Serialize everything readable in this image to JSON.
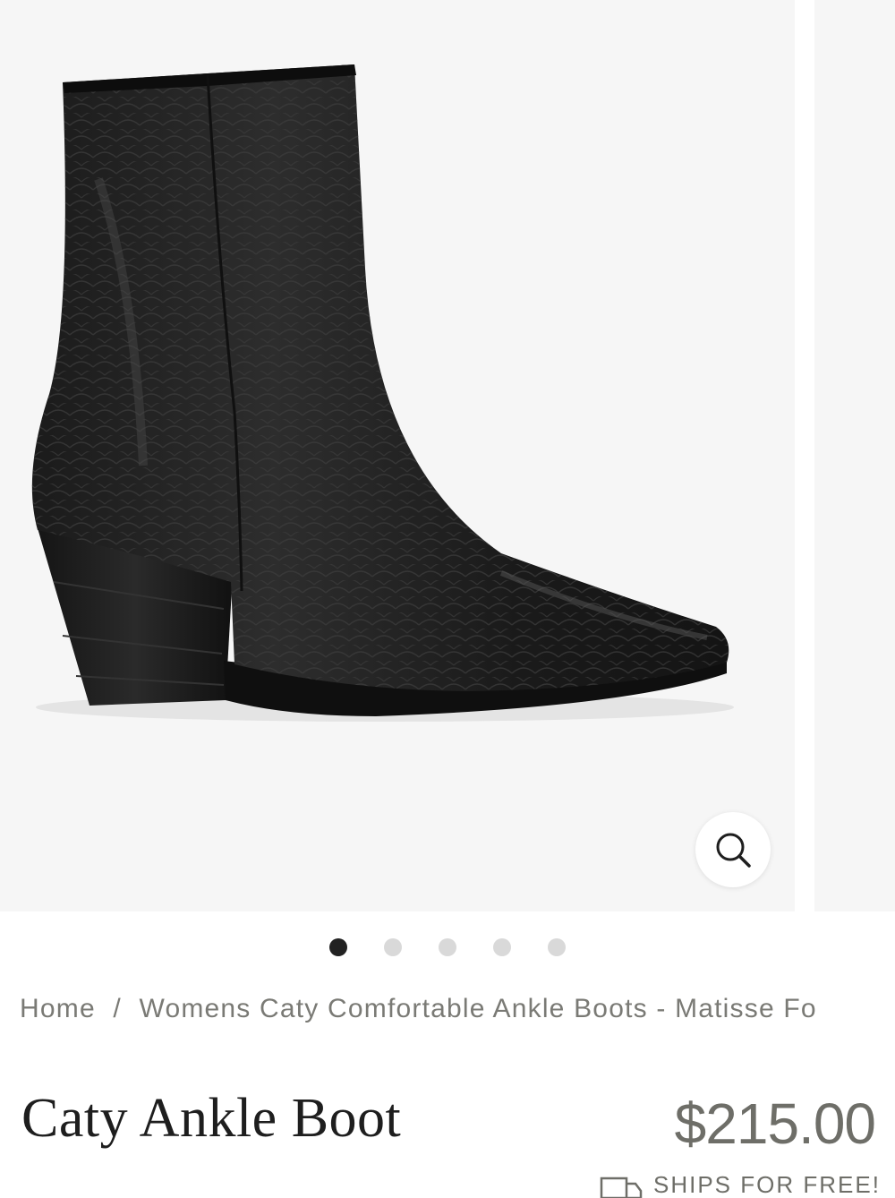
{
  "gallery": {
    "slide_count": 5,
    "active_slide": 1,
    "image_alt": "Caty Ankle Boot",
    "zoom_icon": "magnifier-icon"
  },
  "breadcrumb": {
    "home": "Home",
    "separator": "/",
    "current": "Womens Caty Comfortable Ankle Boots - Matisse Fo"
  },
  "product": {
    "title": "Caty Ankle Boot",
    "price": "$215.00"
  },
  "shipping": {
    "icon": "truck-icon",
    "label": "SHIPS FOR FREE!"
  },
  "colors": {
    "dot_active": "#222222",
    "dot_inactive": "#d9d9d9",
    "price": "#6e6e68",
    "breadcrumb": "#7a7a75"
  }
}
